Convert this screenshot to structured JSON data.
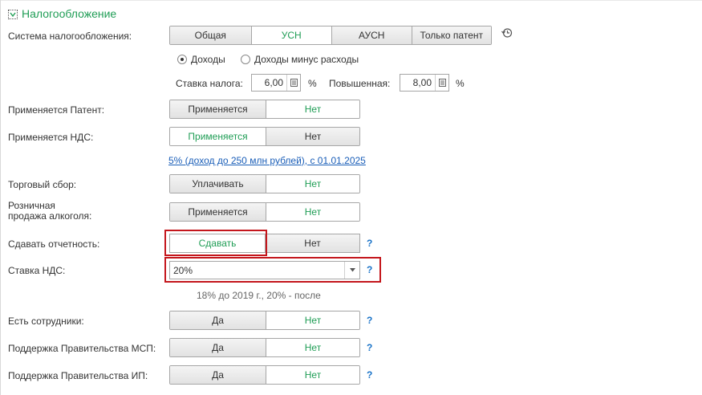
{
  "section": {
    "title": "Налогообложение"
  },
  "tax_system": {
    "label": "Система налогообложения:",
    "options": [
      "Общая",
      "УСН",
      "АУСН",
      "Только патент"
    ],
    "selected": "УСН"
  },
  "usn_object": {
    "options": [
      "Доходы",
      "Доходы минус расходы"
    ],
    "selected": "Доходы"
  },
  "rates": {
    "rate_label": "Ставка налога:",
    "rate_value": "6,00",
    "percent": "%",
    "increased_label": "Повышенная:",
    "increased_value": "8,00",
    "increased_percent": "%"
  },
  "patent": {
    "label": "Применяется Патент:",
    "yes": "Применяется",
    "no": "Нет",
    "selected": "Нет"
  },
  "nds_applied": {
    "label": "Применяется НДС:",
    "yes": "Применяется",
    "no": "Нет",
    "selected": "Применяется"
  },
  "nds_link": "5% (доход до 250 млн рублей), с 01.01.2025",
  "trade_fee": {
    "label": "Торговый сбор:",
    "yes": "Уплачивать",
    "no": "Нет",
    "selected": "Нет"
  },
  "alcohol": {
    "label_line1": "Розничная",
    "label_line2": "продажа алкоголя:",
    "yes": "Применяется",
    "no": "Нет",
    "selected": "Нет"
  },
  "reporting": {
    "label": "Сдавать отчетность:",
    "yes": "Сдавать",
    "no": "Нет",
    "selected": "Сдавать",
    "help": "?"
  },
  "nds_rate": {
    "label": "Ставка НДС:",
    "value": "20%",
    "help": "?",
    "note": "18% до 2019 г., 20% - после"
  },
  "employees": {
    "label": "Есть сотрудники:",
    "yes": "Да",
    "no": "Нет",
    "selected": "Нет",
    "help": "?"
  },
  "msp_support": {
    "label": "Поддержка Правительства МСП:",
    "yes": "Да",
    "no": "Нет",
    "selected": "Нет",
    "help": "?"
  },
  "ip_support": {
    "label": "Поддержка Правительства ИП:",
    "yes": "Да",
    "no": "Нет",
    "selected": "Нет",
    "help": "?"
  },
  "colors": {
    "accent_green": "#1f9d55",
    "link_blue": "#1a5eb8",
    "highlight_red": "#c4161c"
  }
}
